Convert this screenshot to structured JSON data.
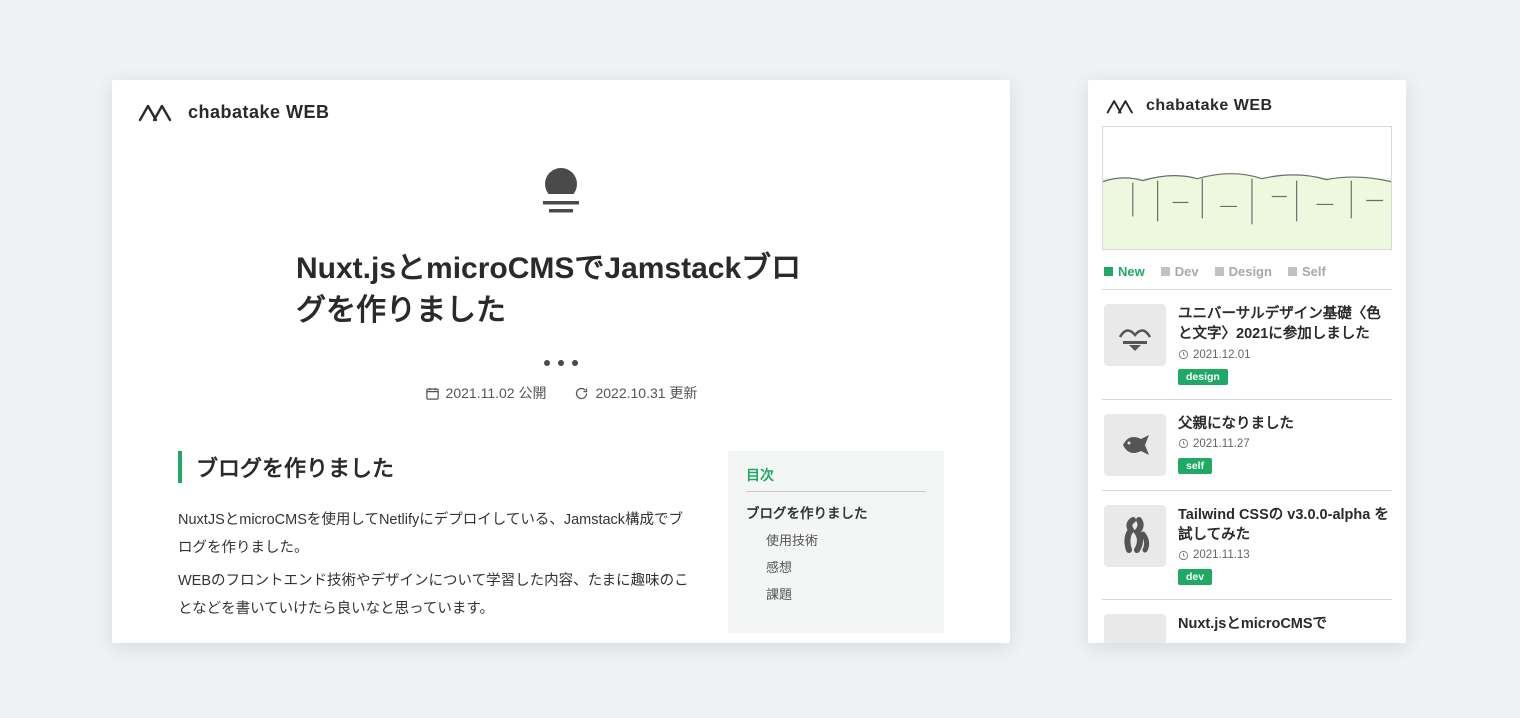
{
  "brand": {
    "name": "chabatake WEB"
  },
  "article": {
    "title": "Nuxt.jsとmicroCMSでJamstackブログを作りました",
    "published_label": "2021.11.02 公開",
    "updated_label": "2022.10.31 更新",
    "section_heading": "ブログを作りました",
    "paragraphs": [
      "NuxtJSとmicroCMSを使用してNetlifyにデプロイしている、Jamstack構成でブログを作りました。",
      "WEBのフロントエンド技術やデザインについて学習した内容、たまに趣味のことなどを書いていけたら良いなと思っています。"
    ],
    "toc": {
      "title": "目次",
      "items": [
        {
          "level": 1,
          "label": "ブログを作りました"
        },
        {
          "level": 2,
          "label": "使用技術"
        },
        {
          "level": 2,
          "label": "感想"
        },
        {
          "level": 2,
          "label": "課題"
        }
      ]
    }
  },
  "mobile": {
    "filters": [
      {
        "label": "New",
        "active": true
      },
      {
        "label": "Dev",
        "active": false
      },
      {
        "label": "Design",
        "active": false
      },
      {
        "label": "Self",
        "active": false
      }
    ],
    "posts": [
      {
        "title": "ユニバーサルデザイン基礎〈色と文字〉2021に参加しました",
        "date": "2021.12.01",
        "tag": "design"
      },
      {
        "title": "父親になりました",
        "date": "2021.11.27",
        "tag": "self"
      },
      {
        "title": "Tailwind CSSの v3.0.0-alpha を試してみた",
        "date": "2021.11.13",
        "tag": "dev"
      },
      {
        "title": "Nuxt.jsとmicroCMSで",
        "date": "",
        "tag": ""
      }
    ]
  },
  "accent_color": "#1fa965"
}
